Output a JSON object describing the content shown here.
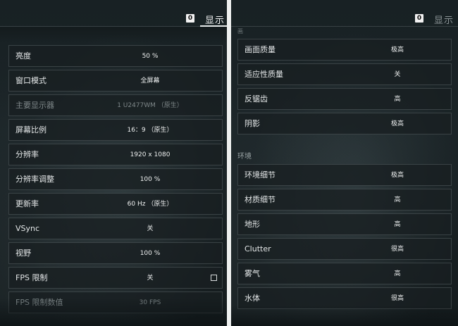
{
  "left": {
    "header": {
      "key_badge": "0",
      "title": "显示"
    },
    "settings": [
      {
        "label": "亮度",
        "value": "50 %"
      },
      {
        "label": "窗口模式",
        "value": "全屏幕"
      },
      {
        "label": "主要显示器",
        "value": "1 U2477WM （原生）",
        "disabled": true
      },
      {
        "label": "屏幕比例",
        "value": "16：9 （原生）"
      },
      {
        "label": "分辨率",
        "value": "1920 x 1080"
      },
      {
        "label": "分辨率调整",
        "value": "100 %"
      },
      {
        "label": "更新率",
        "value": "60 Hz （原生）"
      },
      {
        "label": "VSync",
        "value": "关"
      },
      {
        "label": "视野",
        "value": "100 %"
      },
      {
        "label": "FPS 限制",
        "value": "关"
      },
      {
        "label": "FPS 限制数值",
        "value": "30 FPS",
        "disabled": true
      }
    ]
  },
  "right": {
    "header": {
      "key_badge": "0",
      "title": "显示"
    },
    "cut_section_label": "画",
    "graphics": [
      {
        "label": "画面质量",
        "value": "极高"
      },
      {
        "label": "适应性质量",
        "value": "关"
      },
      {
        "label": "反锯齿",
        "value": "高"
      },
      {
        "label": "阴影",
        "value": "极高"
      }
    ],
    "environment_section": "环境",
    "environment": [
      {
        "label": "环境细节",
        "value": "极高"
      },
      {
        "label": "材质细节",
        "value": "高"
      },
      {
        "label": "地形",
        "value": "高"
      },
      {
        "label": "Clutter",
        "value": "很高"
      },
      {
        "label": "雾气",
        "value": "高"
      },
      {
        "label": "水体",
        "value": "很高"
      }
    ]
  }
}
